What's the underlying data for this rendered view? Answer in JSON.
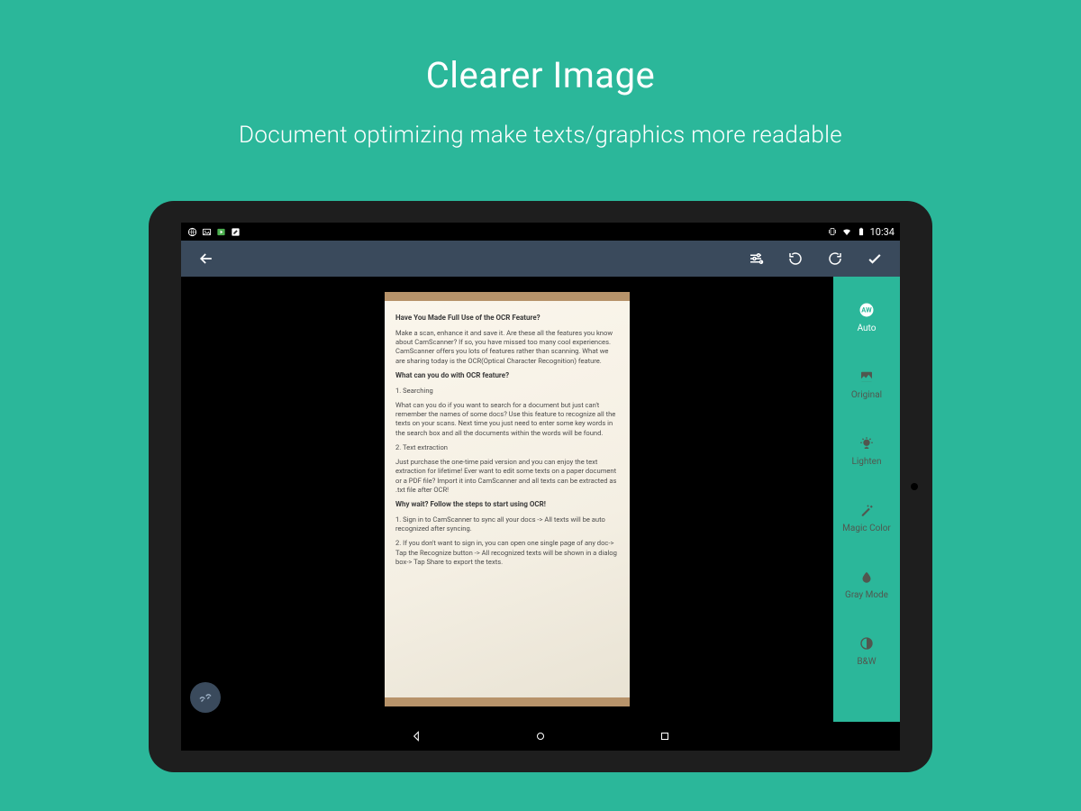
{
  "promo": {
    "title": "Clearer Image",
    "subtitle": "Document optimizing make texts/graphics more readable"
  },
  "status_bar": {
    "time": "10:34"
  },
  "filters": [
    {
      "label": "Auto",
      "active": true
    },
    {
      "label": "Original",
      "active": false
    },
    {
      "label": "Lighten",
      "active": false
    },
    {
      "label": "Magic Color",
      "active": false
    },
    {
      "label": "Gray Mode",
      "active": false
    },
    {
      "label": "B&W",
      "active": false
    }
  ],
  "document": {
    "h1": "Have You Made Full Use of the OCR Feature?",
    "intro": "Make a scan, enhance it and save it. Are these all the features you know about CamScanner? If so, you have missed too many cool experiences. CamScanner offers you lots of features rather than scanning. What we are sharing today is the OCR(Optical Character Recognition) feature.",
    "h2": "What can you do with OCR feature?",
    "p1_title": "1. Searching",
    "p1": "What can you do if you want to search for a document but just can't remember the names of some docs? Use this feature to recognize all the texts on your scans. Next time you just need to enter some key words in the search box and all the documents within the words will be found.",
    "p2_title": "2. Text extraction",
    "p2": "Just purchase the one-time paid version and you can enjoy the text extraction for lifetime! Ever want to edit some texts on a paper document or a PDF file? Import it into CamScanner and all texts can be extracted as .txt file after OCR!",
    "h3": "Why wait? Follow the steps to start using OCR!",
    "s1": "1. Sign in to CamScanner to sync all your docs -> All texts will be auto recognized after syncing.",
    "s2": "2. If you don't want to sign in, you can open one single page of any doc-> Tap the Recognize button -> All recognized texts will be shown in a dialog box-> Tap Share to export the texts."
  }
}
